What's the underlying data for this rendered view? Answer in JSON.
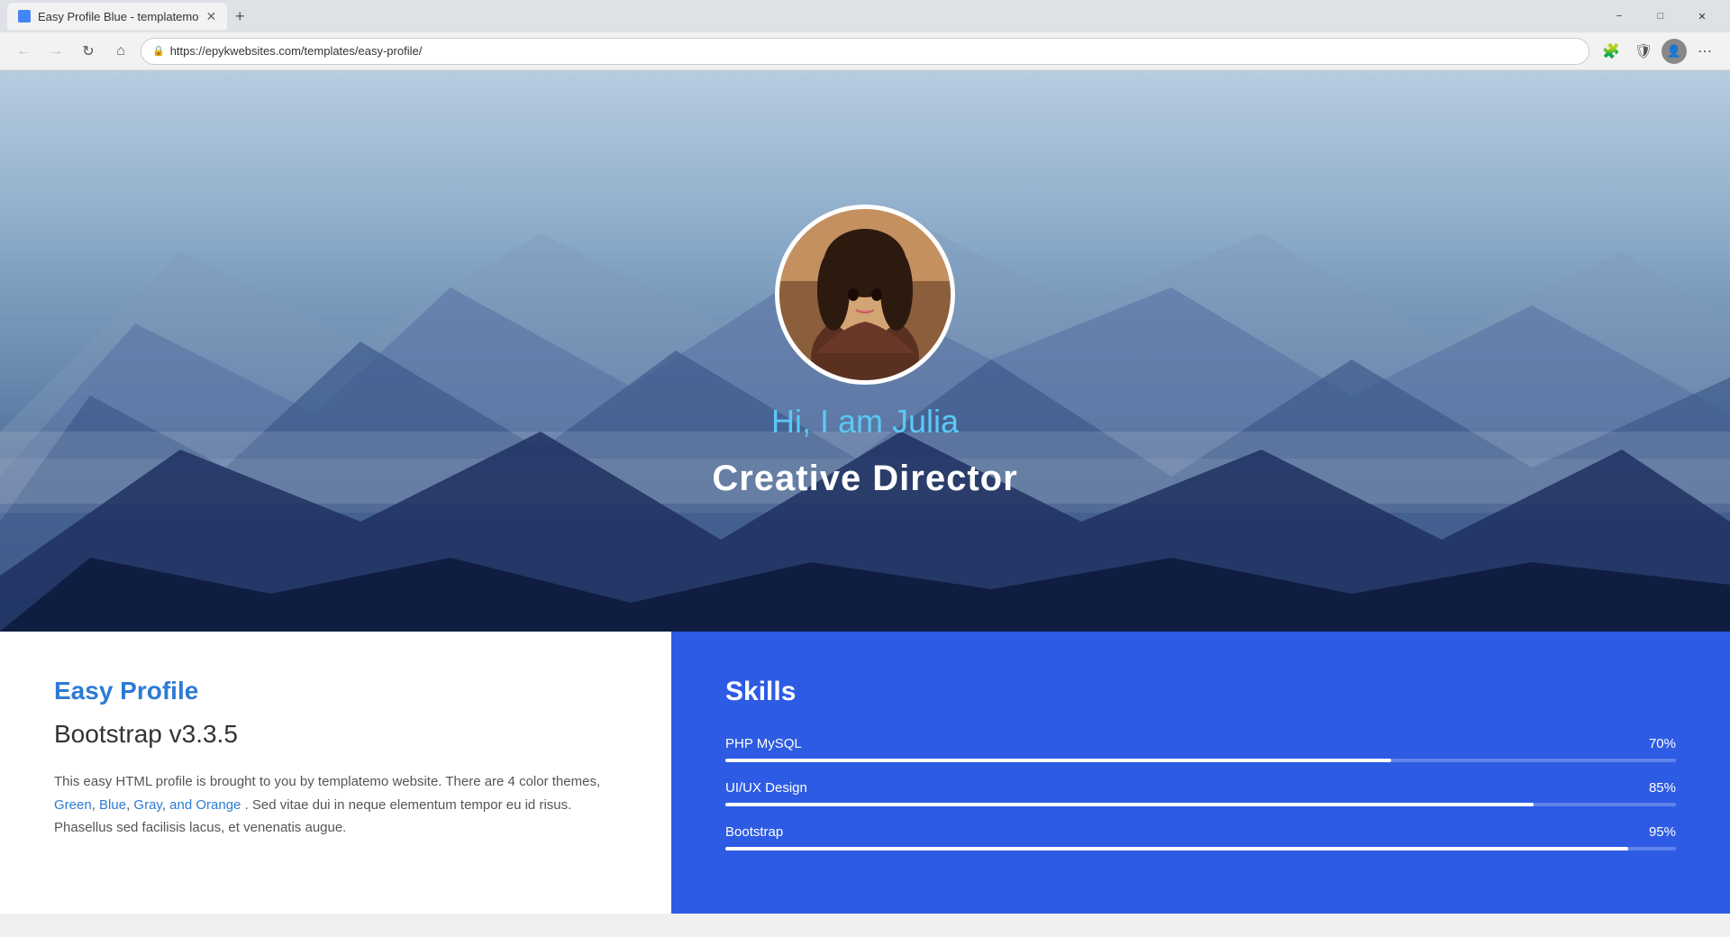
{
  "browser": {
    "tab_title": "Easy Profile Blue - templatemo",
    "new_tab_label": "+",
    "url": "https://epykwebsites.com/templates/easy-profile/",
    "back_icon": "←",
    "forward_icon": "→",
    "reload_icon": "↻",
    "home_icon": "⌂",
    "lock_icon": "🔒",
    "extensions_icon": "🧩",
    "shield_icon": "🛡",
    "menu_icon": "⋯",
    "minimize_icon": "−",
    "maximize_icon": "□",
    "close_icon": "✕"
  },
  "hero": {
    "greeting": "Hi, I am Julia",
    "job_title": "Creative Director"
  },
  "about": {
    "title": "Easy Profile",
    "subtitle": "Bootstrap v3.3.5",
    "body": "This easy HTML profile is brought to you by templatemo website. There are 4 color themes,",
    "links": [
      "Green",
      "Blue",
      "Gray",
      "and Orange"
    ],
    "body2": ". Sed vitae dui in neque elementum tempor eu id risus. Phasellus sed facilisis lacus, et venenatis augue."
  },
  "skills": {
    "section_title": "Skills",
    "items": [
      {
        "name": "PHP MySQL",
        "pct": 70,
        "label": "70%"
      },
      {
        "name": "UI/UX Design",
        "pct": 85,
        "label": "85%"
      },
      {
        "name": "Bootstrap",
        "pct": 95,
        "label": "95%"
      }
    ]
  }
}
